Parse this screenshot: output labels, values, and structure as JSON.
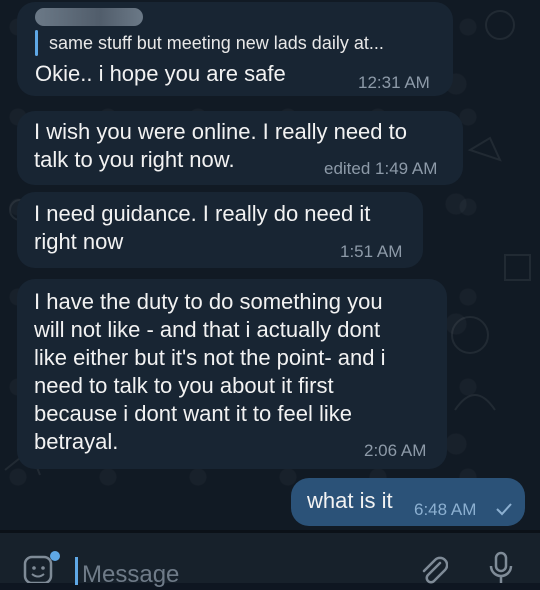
{
  "messages": [
    {
      "reply_preview": "same stuff but meeting new lads daily at...",
      "text": "Okie.. i hope you are safe",
      "time": "12:31 AM"
    },
    {
      "text": "I wish you were online. I really need to\ntalk to you right now.",
      "time": "edited 1:49 AM"
    },
    {
      "text": "I need guidance. I really do need it\nright now",
      "time": "1:51 AM"
    },
    {
      "text": "I have the duty to do something you\nwill not like - and that i actually dont\nlike either but it's not the point- and i\nneed to talk to you about it first\nbecause i dont want it to feel like\nbetrayal.",
      "time": "2:06 AM"
    },
    {
      "text": "what is it",
      "time": "6:48 AM",
      "status_icon": "check-icon"
    }
  ],
  "composer": {
    "placeholder": "Message",
    "icons": [
      "sticker-icon",
      "attach-icon",
      "microphone-icon"
    ]
  },
  "colors": {
    "incoming_bubble": "#182533",
    "outgoing_bubble": "#2b5278",
    "accent": "#5fa8e6"
  }
}
